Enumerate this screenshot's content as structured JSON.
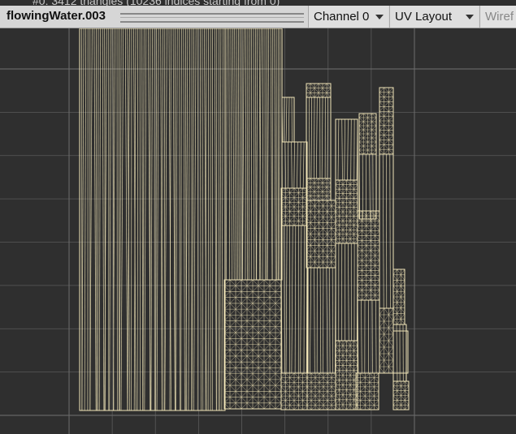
{
  "header": {
    "mesh_name": "flowingWater.003",
    "submesh_info": "#0: 3412 triangles (10236 indices starting from 0)"
  },
  "toolbar": {
    "channel_label": "Channel 0",
    "layout_label": "UV Layout",
    "mode_label": "Wiref"
  },
  "icons": {
    "channel_dropdown": "chevron-down-icon",
    "layout_dropdown": "chevron-down-icon"
  },
  "colors": {
    "background": "#2f2f2f",
    "grid": "#6a6a6a",
    "wire": "#f2e6b8",
    "toolbar": "#d6d6d6"
  }
}
